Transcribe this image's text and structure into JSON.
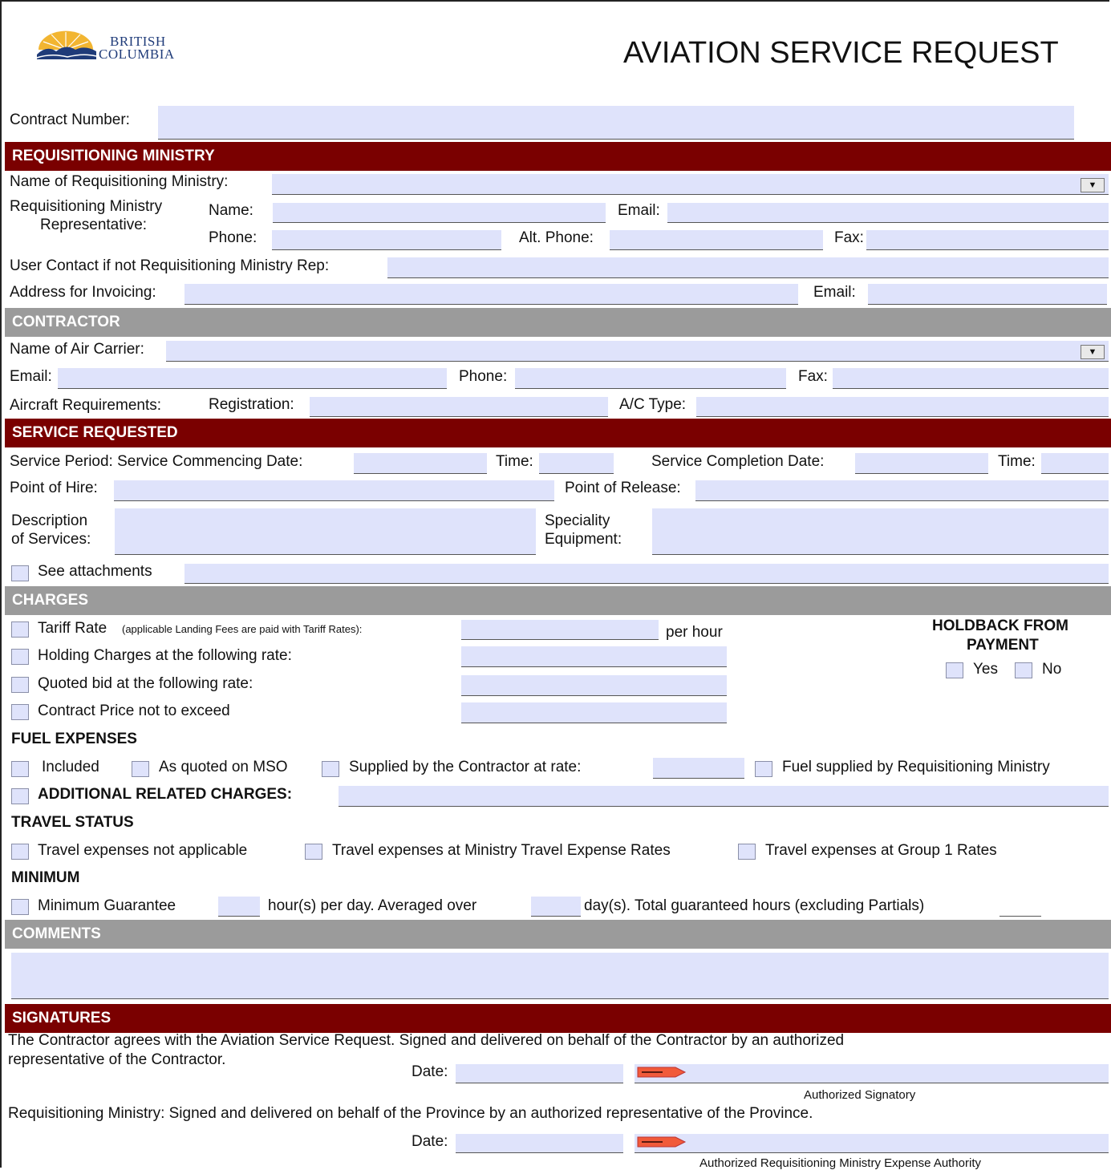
{
  "header": {
    "logo_line1": "BRITISH",
    "logo_line2": "COLUMBIA",
    "title": "AVIATION SERVICE REQUEST"
  },
  "contract": {
    "label": "Contract Number:"
  },
  "sections": {
    "requisitioning": "REQUISITIONING MINISTRY",
    "contractor": "CONTRACTOR",
    "service": "SERVICE REQUESTED",
    "charges": "CHARGES",
    "comments": "COMMENTS",
    "signatures": "SIGNATURES"
  },
  "ministry": {
    "name_label": "Name of Requisitioning Ministry:",
    "rep_label_1": "Requisitioning Ministry",
    "rep_label_2": "Representative:",
    "name": "Name:",
    "email": "Email:",
    "phone": "Phone:",
    "alt_phone": "Alt. Phone:",
    "fax": "Fax:",
    "user_contact": "User Contact if not Requisitioning Ministry Rep:",
    "invoice_address": "Address for Invoicing:",
    "invoice_email": "Email:"
  },
  "contractor": {
    "air_carrier": "Name of Air Carrier:",
    "email": "Email:",
    "phone": "Phone:",
    "fax": "Fax:",
    "aircraft_req": "Aircraft Requirements:",
    "registration": "Registration:",
    "ac_type": "A/C Type:"
  },
  "service": {
    "commencing": "Service Period: Service Commencing Date:",
    "time1": "Time:",
    "completion": "Service Completion Date:",
    "time2": "Time:",
    "point_hire": "Point of Hire:",
    "point_release": "Point of Release:",
    "desc_1": "Description",
    "desc_2": "of Services:",
    "spec_1": "Speciality",
    "spec_2": "Equipment:",
    "see_attachments": "See attachments"
  },
  "charges": {
    "tariff": "Tariff Rate",
    "tariff_note": "(applicable Landing Fees are paid with Tariff Rates):",
    "per_hour": "per hour",
    "holding": "Holding Charges at the following rate:",
    "quoted": "Quoted bid at the following rate:",
    "contract_price": "Contract Price not to exceed",
    "holdback_1": "HOLDBACK FROM",
    "holdback_2": "PAYMENT",
    "yes": "Yes",
    "no": "No",
    "fuel_heading": "FUEL EXPENSES",
    "fuel_included": "Included",
    "fuel_quoted": "As quoted on MSO",
    "fuel_supplied_contractor": "Supplied by the Contractor at rate:",
    "fuel_supplied_ministry": "Fuel supplied by Requisitioning Ministry",
    "additional": "ADDITIONAL RELATED CHARGES:",
    "travel_heading": "TRAVEL STATUS",
    "travel_na": "Travel expenses not applicable",
    "travel_ministry": "Travel expenses at Ministry Travel Expense Rates",
    "travel_group1": "Travel expenses at Group 1 Rates",
    "minimum_heading": "MINIMUM",
    "min_guarantee": "Minimum Guarantee",
    "hours_per_day": "hour(s) per day.  Averaged over",
    "days": "day(s).   Total guaranteed hours (excluding Partials)"
  },
  "signatures": {
    "contractor_text_1": "The Contractor agrees with the Aviation Service Request.  Signed and delivered on behalf of the Contractor by an authorized",
    "contractor_text_2": "representative of the Contractor.",
    "date1": "Date:",
    "authorized_signatory": "Authorized Signatory",
    "ministry_text": "Requisitioning Ministry:  Signed and delivered on behalf of the Province by an authorized representative of the Province.",
    "date2": "Date:",
    "authorized_expense": "Authorized Requisitioning Ministry Expense Authority"
  },
  "colors": {
    "section_red": "#7a0000",
    "section_gray": "#9b9b9b",
    "field_fill": "#dfe3fb"
  }
}
